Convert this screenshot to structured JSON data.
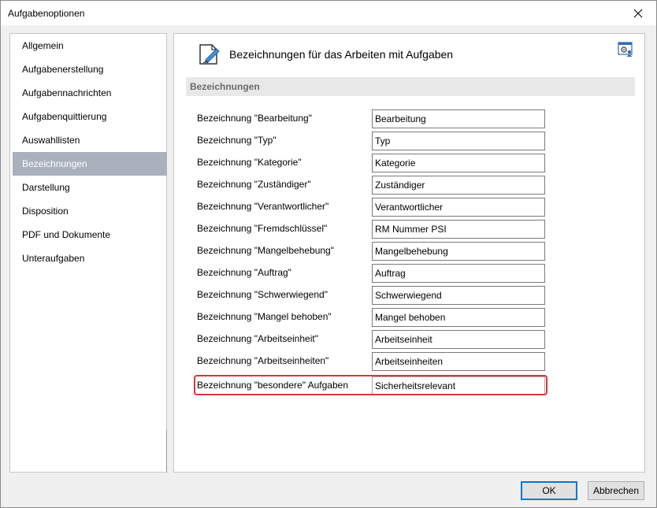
{
  "window": {
    "title": "Aufgabenoptionen"
  },
  "sidebar": {
    "items": [
      {
        "label": "Allgemein"
      },
      {
        "label": "Aufgabenerstellung"
      },
      {
        "label": "Aufgabennachrichten"
      },
      {
        "label": "Aufgabenquittierung"
      },
      {
        "label": "Auswahllisten"
      },
      {
        "label": "Bezeichnungen",
        "selected": true
      },
      {
        "label": "Darstellung"
      },
      {
        "label": "Disposition"
      },
      {
        "label": "PDF und Dokumente"
      },
      {
        "label": "Unteraufgaben"
      }
    ],
    "selected_color": "#a9b1bd"
  },
  "main": {
    "header_title": "Bezeichnungen für das Arbeiten mit Aufgaben",
    "header_icon": "edit-document-icon",
    "settings_icon": "user-settings-icon",
    "section_title": "Bezeichnungen",
    "rows": [
      {
        "label": "Bezeichnung \"Bearbeitung\"",
        "value": "Bearbeitung"
      },
      {
        "label": "Bezeichnung \"Typ\"",
        "value": "Typ"
      },
      {
        "label": "Bezeichnung \"Kategorie\"",
        "value": "Kategorie"
      },
      {
        "label": "Bezeichnung \"Zuständiger\"",
        "value": "Zuständiger"
      },
      {
        "label": "Bezeichnung \"Verantwortlicher\"",
        "value": "Verantwortlicher"
      },
      {
        "label": "Bezeichnung \"Fremdschlüssel\"",
        "value": "RM Nummer PSI"
      },
      {
        "label": "Bezeichnung \"Mangelbehebung\"",
        "value": "Mangelbehebung"
      },
      {
        "label": "Bezeichnung \"Auftrag\"",
        "value": "Auftrag"
      },
      {
        "label": "Bezeichnung \"Schwerwiegend\"",
        "value": "Schwerwiegend"
      },
      {
        "label": "Bezeichnung \"Mangel behoben\"",
        "value": "Mangel behoben"
      },
      {
        "label": "Bezeichnung \"Arbeitseinheit\"",
        "value": "Arbeitseinheit"
      },
      {
        "label": "Bezeichnung \"Arbeitseinheiten\"",
        "value": "Arbeitseinheiten"
      },
      {
        "label": "Bezeichnung \"besondere\" Aufgaben",
        "value": "Sicherheitsrelevant",
        "highlighted": true
      }
    ],
    "highlight_color": "#e0323a"
  },
  "buttons": {
    "ok": "OK",
    "cancel": "Abbrechen"
  },
  "accent_color": "#0078d7"
}
